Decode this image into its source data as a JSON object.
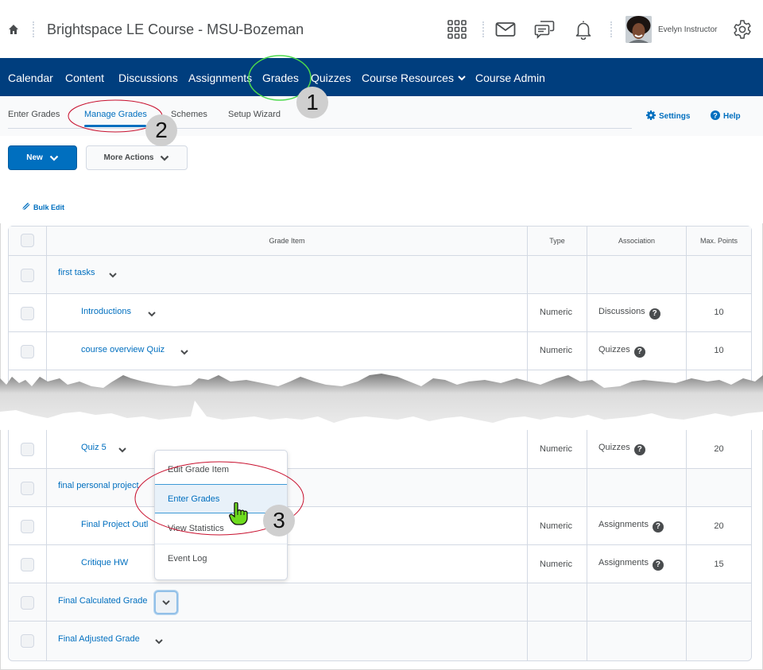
{
  "header": {
    "course_title": "Brightspace LE Course - MSU-Bozeman",
    "user_name": "Evelyn Instructor",
    "icons": [
      "home-icon",
      "apps-grid-icon",
      "mail-icon",
      "chat-icon",
      "bell-icon",
      "avatar",
      "gear-icon"
    ]
  },
  "navbar": {
    "items": [
      {
        "label": "Calendar"
      },
      {
        "label": "Content"
      },
      {
        "label": "Discussions"
      },
      {
        "label": "Assignments"
      },
      {
        "label": "Grades"
      },
      {
        "label": "Quizzes"
      },
      {
        "label": "Course Resources",
        "has_dropdown": true
      },
      {
        "label": "Course Admin"
      }
    ]
  },
  "subnav": {
    "tabs": [
      {
        "label": "Enter Grades"
      },
      {
        "label": "Manage Grades",
        "active": true
      },
      {
        "label": "Schemes"
      },
      {
        "label": "Setup Wizard"
      }
    ],
    "settings_label": "Settings",
    "help_label": "Help"
  },
  "toolbar": {
    "new_label": "New",
    "more_actions_label": "More Actions",
    "bulk_edit_label": "Bulk Edit"
  },
  "table": {
    "columns": [
      "Grade Item",
      "Type",
      "Association",
      "Max. Points"
    ],
    "rows": [
      {
        "name": "first tasks",
        "category": true,
        "type": "",
        "association": "",
        "max": ""
      },
      {
        "name": "Introductions",
        "category": false,
        "type": "Numeric",
        "association": "Discussions",
        "max": "10"
      },
      {
        "name": "course overview Quiz",
        "category": false,
        "type": "Numeric",
        "association": "Quizzes",
        "max": "10"
      },
      {
        "name": "Quiz 5",
        "category": false,
        "type": "Numeric",
        "association": "Quizzes",
        "max": "20"
      },
      {
        "name": "final personal project",
        "category": true,
        "type": "",
        "association": "",
        "max": ""
      },
      {
        "name": "Final Project Outl",
        "category": false,
        "type": "Numeric",
        "association": "Assignments",
        "max": "20"
      },
      {
        "name": "Critique HW",
        "category": false,
        "type": "Numeric",
        "association": "Assignments",
        "max": "15"
      },
      {
        "name": "Final Calculated Grade",
        "category": true,
        "type": "",
        "association": "",
        "max": ""
      },
      {
        "name": "Final Adjusted Grade",
        "category": true,
        "type": "",
        "association": "",
        "max": ""
      }
    ]
  },
  "context_menu": {
    "items": [
      {
        "label": "Edit Grade Item"
      },
      {
        "label": "Enter Grades",
        "highlighted": true
      },
      {
        "label": "View Statistics"
      },
      {
        "label": "Event Log"
      }
    ]
  },
  "annotations": {
    "step1": "1",
    "step2": "2",
    "step3": "3",
    "colors": {
      "circle_green": "#4cd94c",
      "circle_red": "#c8102e",
      "badge": "#cfcfcf"
    }
  },
  "colors": {
    "navbar": "#003e7e",
    "accent": "#006fbf",
    "text": "#494c4e",
    "row_gray": "#f9fafb"
  }
}
